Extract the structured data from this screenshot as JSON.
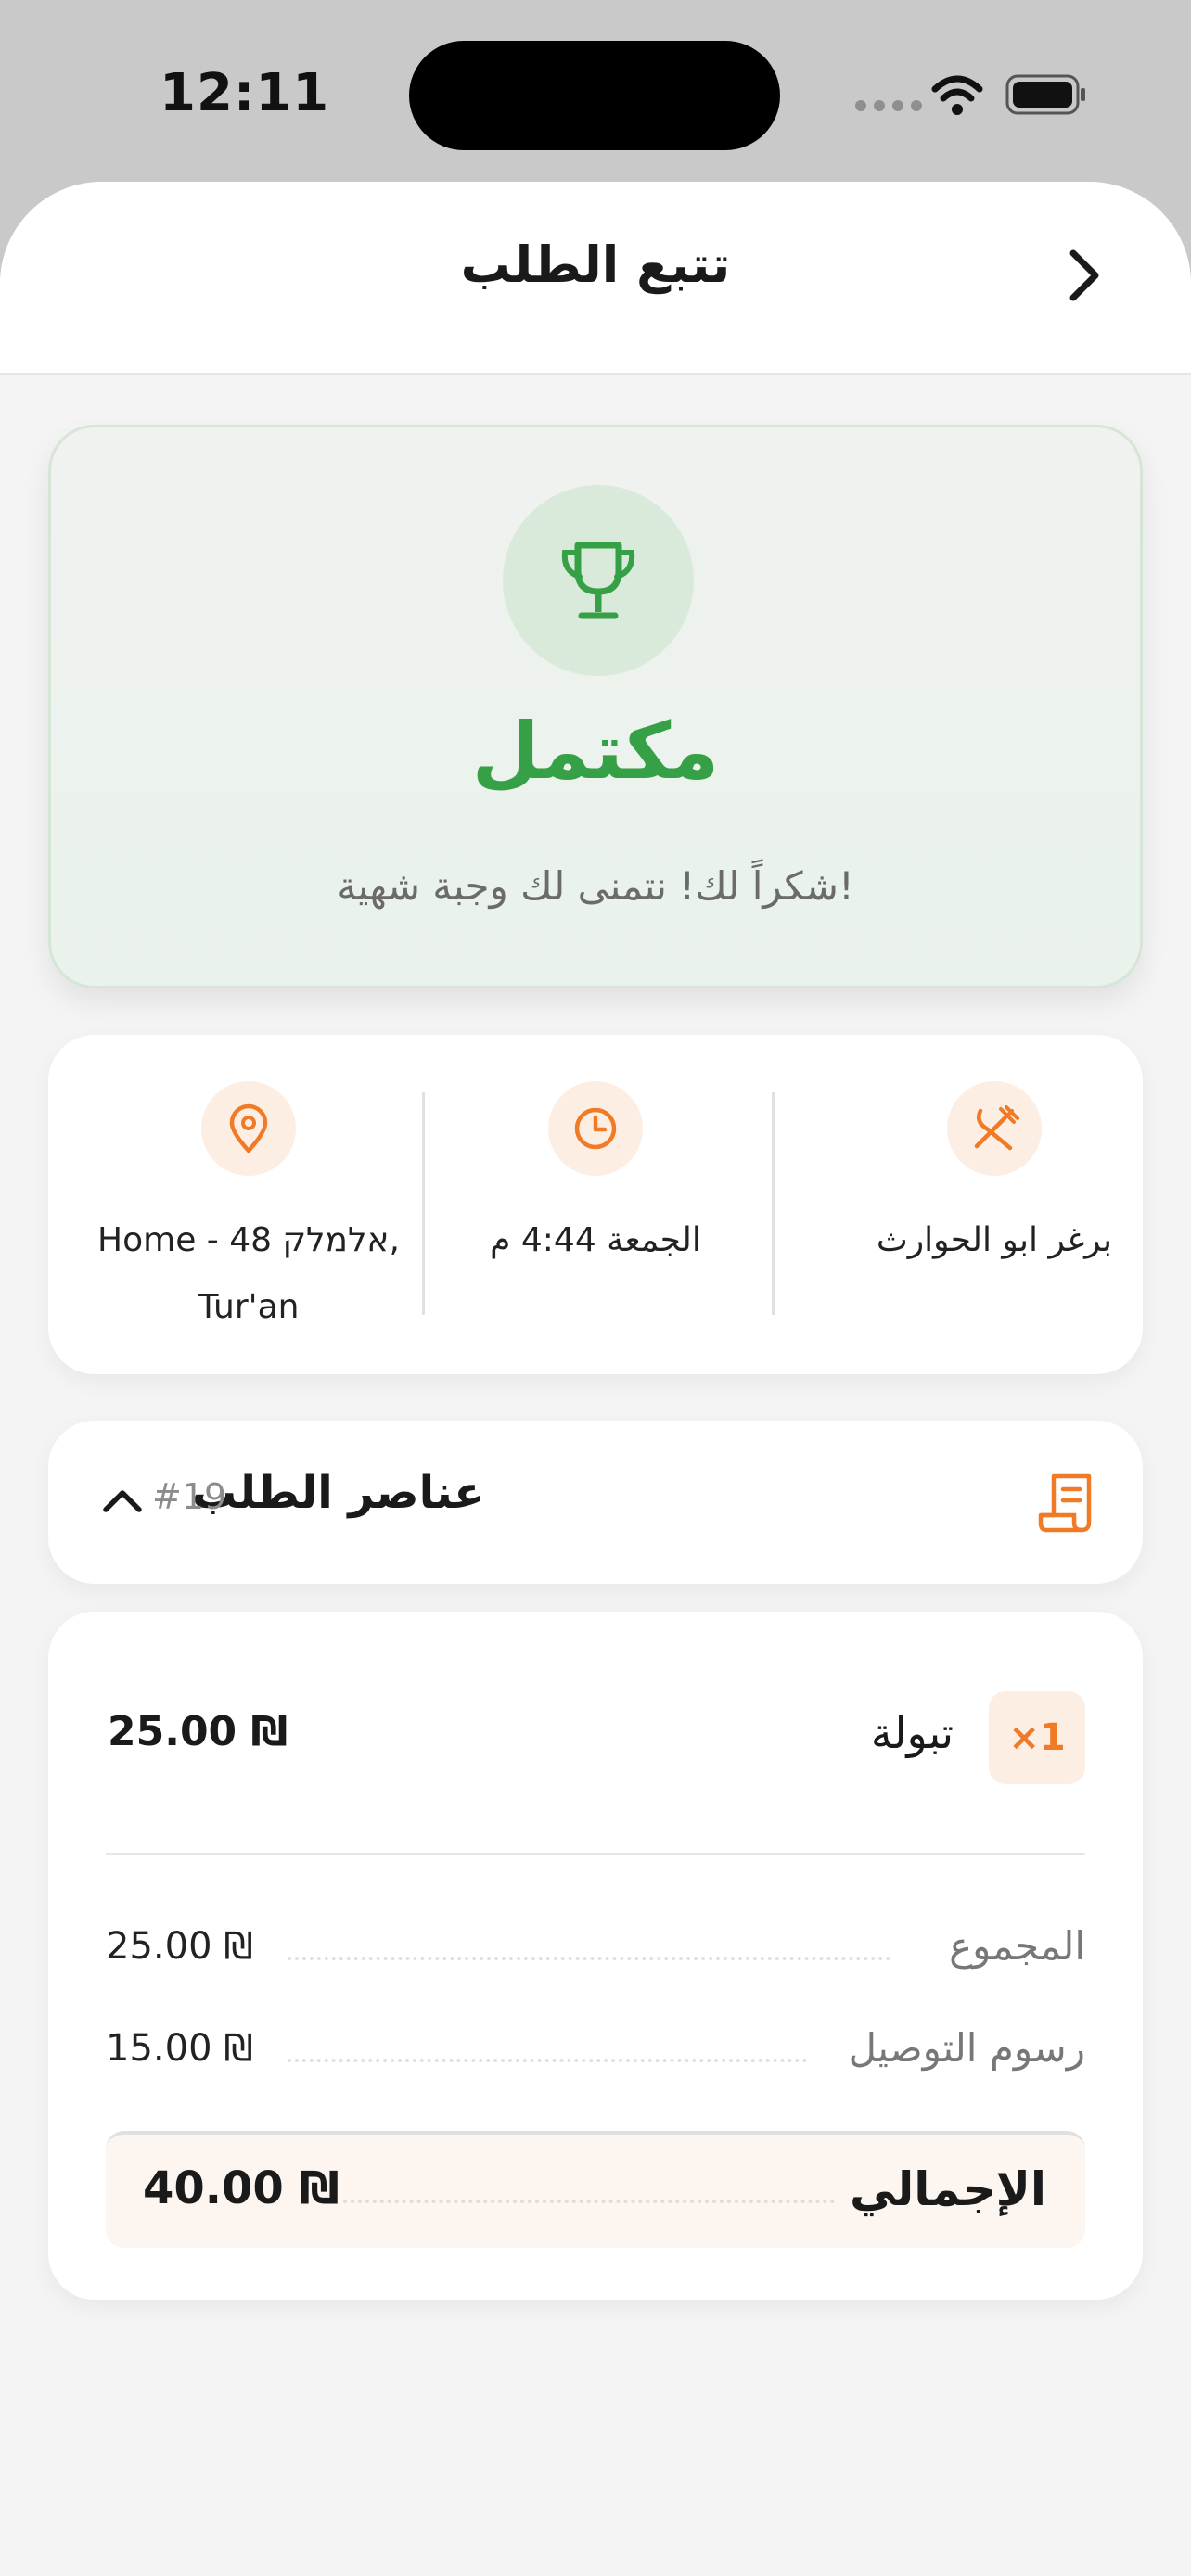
{
  "status_bar": {
    "time": "12:11"
  },
  "header": {
    "title": "تتبع الطلب"
  },
  "status": {
    "title": "مكتمل",
    "message": "شكراً لك! نتمنى لك وجبة شهية!",
    "color": "#35a046"
  },
  "info": {
    "restaurant": "برغر ابو الحوارث",
    "time": "الجمعة 4:44 م",
    "address_line1": "Home - אלמלק 48,",
    "address_line2": "Tur'an"
  },
  "items_section": {
    "title": "عناصر الطلب",
    "order_number": "#19"
  },
  "items": [
    {
      "quantity": "×1",
      "name": "تبولة",
      "price": "₪ 25.00"
    }
  ],
  "summary": {
    "subtotal_label": "المجموع",
    "subtotal_value": "₪ 25.00",
    "delivery_label": "رسوم التوصيل",
    "delivery_value": "₪ 15.00",
    "total_label": "الإجمالي",
    "total_value": "₪ 40.00"
  },
  "colors": {
    "accent": "#f07a26",
    "success": "#35a046"
  }
}
